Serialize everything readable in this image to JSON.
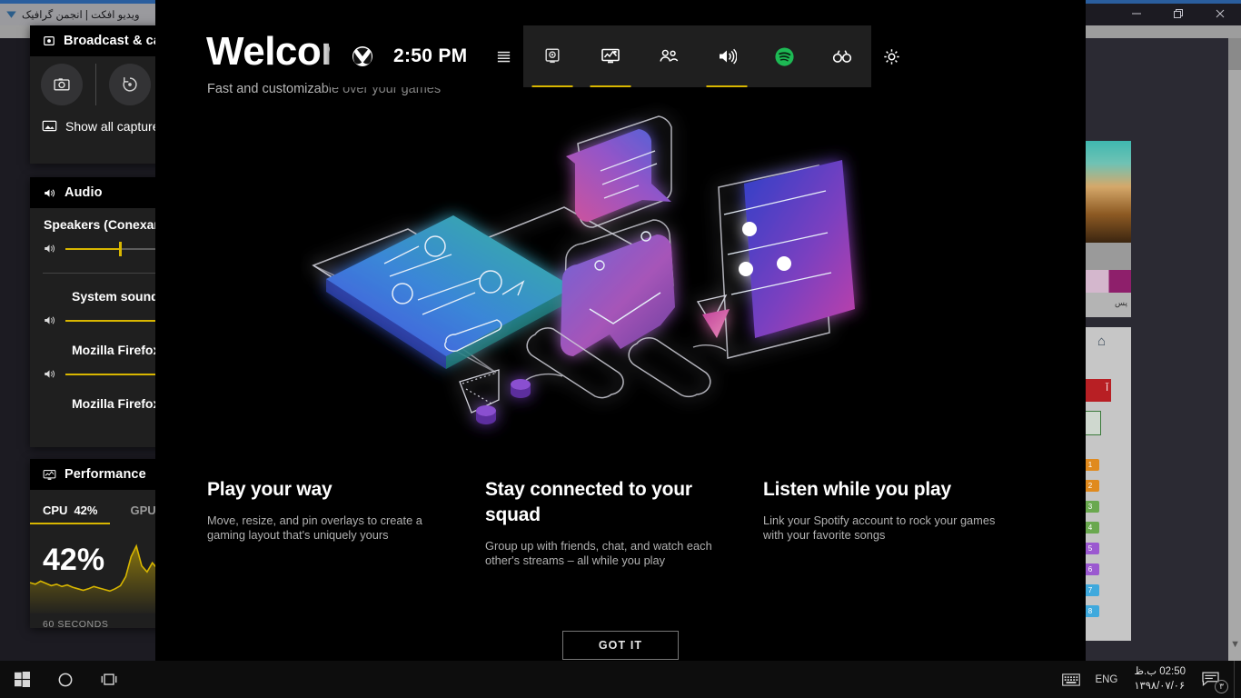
{
  "browser": {
    "tab_title": "ویدیو افکت | انجمن گرافیک",
    "favicon": "firefox-favicon",
    "window_controls": [
      {
        "name": "minimize-button",
        "glyph": "—"
      },
      {
        "name": "maximize-button",
        "glyph": "❐"
      },
      {
        "name": "close-button",
        "glyph": "✕"
      }
    ],
    "sliver": {
      "caption": "پس",
      "red_badge": "آ",
      "chips": [
        "1",
        "2",
        "3",
        "4",
        "5",
        "6",
        "7",
        "8"
      ]
    }
  },
  "taskbar": {
    "start_label": "start-button",
    "cortana_label": "cortana-button",
    "taskview_label": "task-view-button",
    "keyboard_label": "touch-keyboard-button",
    "language": "ENG",
    "clock_time": "02:50 ب.ظ",
    "clock_date": "۱۳۹۸/۰۷/۰۶",
    "notification_count": "۳"
  },
  "gamebar": {
    "hub": {
      "xbox_icon": "xbox-logo-icon",
      "clock": "2:50 PM",
      "menu_icon": "widget-menu-icon",
      "settings_icon": "gear-icon",
      "icons": [
        {
          "name": "capture-icon",
          "label": "Broadcast & capture",
          "active": true
        },
        {
          "name": "performance-icon",
          "label": "Performance",
          "active": true
        },
        {
          "name": "xbox-social-icon",
          "label": "Xbox Social",
          "active": false
        },
        {
          "name": "audio-icon",
          "label": "Audio",
          "active": true
        },
        {
          "name": "spotify-icon",
          "label": "Spotify",
          "active": false
        },
        {
          "name": "looking-for-group-icon",
          "label": "Looking for group",
          "active": false
        }
      ]
    },
    "capture_panel": {
      "title": "Broadcast & capture",
      "title_icon": "broadcast-icon",
      "screenshot_button": "screenshot-icon",
      "record_last_button": "record-last-30s-icon",
      "show_all_label": "Show all captures",
      "show_all_icon": "gallery-icon"
    },
    "audio_panel": {
      "title": "Audio",
      "title_icon": "audio-icon",
      "device": "Speakers (Conexant SmartAudio HD)",
      "device_volume_percent": 38,
      "apps": [
        {
          "name": "System sounds",
          "volume_percent": 100
        },
        {
          "name": "Mozilla Firefox",
          "volume_percent": 100
        },
        {
          "name": "Mozilla Firefox",
          "volume_percent": 100
        }
      ]
    },
    "performance_panel": {
      "title": "Performance",
      "title_icon": "performance-icon",
      "tabs": [
        {
          "label": "CPU",
          "value": "42%",
          "active": true
        },
        {
          "label": "GPU",
          "value": "",
          "active": false
        }
      ],
      "big_value": "42%",
      "footer": "60 SECONDS",
      "accent_color": "#d8b600",
      "graph_points": [
        38,
        36,
        40,
        37,
        34,
        36,
        33,
        35,
        32,
        30,
        28,
        30,
        33,
        31,
        29,
        27,
        30,
        34,
        46,
        72,
        86,
        60,
        52,
        64,
        56,
        50,
        54,
        58,
        52,
        48,
        50,
        53,
        49,
        47,
        50,
        48
      ]
    }
  },
  "welcome": {
    "title": "Welcome",
    "subtitle": "Fast and customizable over your games",
    "illustration": "game-bar-overlays-illustration",
    "columns": [
      {
        "heading": "Play your way",
        "body": "Move, resize, and pin overlays to create a gaming layout that's uniquely yours"
      },
      {
        "heading": "Stay connected to your squad",
        "body": "Group up with friends, chat, and watch each other's streams – all while you play"
      },
      {
        "heading": "Listen while you play",
        "body": "Link your Spotify account to rock your games with your favorite songs"
      }
    ],
    "cta_label": "GOT IT"
  },
  "colors": {
    "accent_yellow": "#d8b600",
    "spotify_green": "#1db954",
    "panel_bg": "#1f1f1f",
    "overlay_bg": "#000000"
  }
}
